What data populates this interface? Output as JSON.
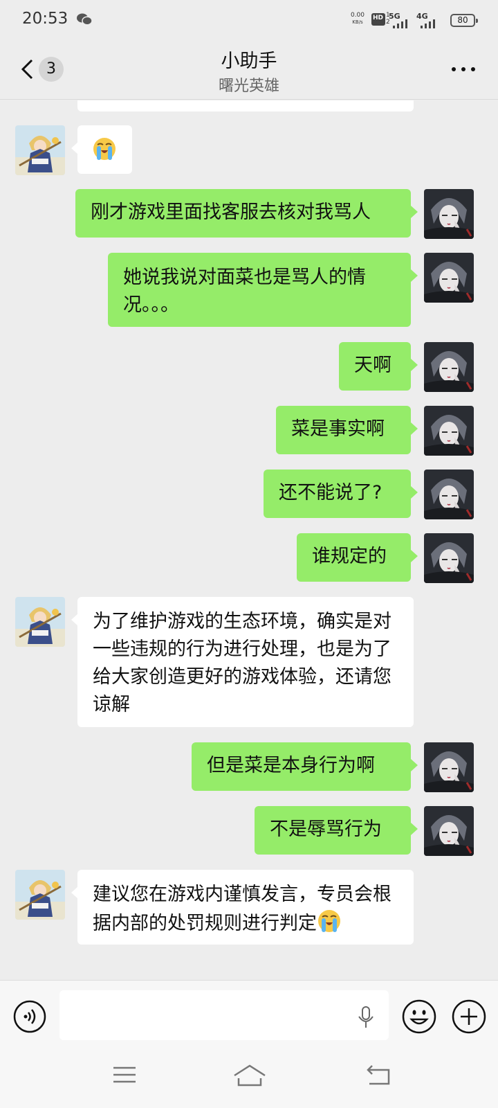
{
  "status_bar": {
    "time": "20:53",
    "net_speed_value": "0.00",
    "net_speed_unit": "KB/s",
    "hd_label": "HD",
    "sim1_gen": "5G",
    "sim2_gen": "4G",
    "battery": "80"
  },
  "header": {
    "back_icon": "chevron-left-icon",
    "unread_count": "3",
    "title": "小助手",
    "subtitle": "曙光英雄",
    "more_icon": "more-dots-icon"
  },
  "messages": [
    {
      "side": "in",
      "text": "",
      "partial": true
    },
    {
      "side": "in",
      "text": "",
      "emoji": "crying-face"
    },
    {
      "side": "out",
      "text": "刚才游戏里面找客服去核对我骂人"
    },
    {
      "side": "out",
      "text": "她说我说对面菜也是骂人的情况。。。"
    },
    {
      "side": "out",
      "text": "天啊"
    },
    {
      "side": "out",
      "text": "菜是事实啊"
    },
    {
      "side": "out",
      "text": "还不能说了?"
    },
    {
      "side": "out",
      "text": "谁规定的"
    },
    {
      "side": "in",
      "text": "为了维护游戏的生态环境，确实是对一些违规的行为进行处理，也是为了给大家创造更好的游戏体验，还请您谅解"
    },
    {
      "side": "out",
      "text": "但是菜是本身行为啊"
    },
    {
      "side": "out",
      "text": "不是辱骂行为"
    },
    {
      "side": "in",
      "text": "建议您在游戏内谨慎发言，专员会根据内部的处罚规则进行判定",
      "emoji": "crying-face"
    }
  ],
  "input_bar": {
    "voice_icon": "voice-mode-icon",
    "input_value": "",
    "mic_icon": "microphone-icon",
    "emoji_icon": "emoji-icon",
    "plus_icon": "plus-icon"
  },
  "nav_bar": {
    "menu_icon": "menu-icon",
    "home_icon": "home-icon",
    "back_icon": "back-icon"
  },
  "colors": {
    "background": "#ededed",
    "outgoing_bubble": "#95ec69",
    "incoming_bubble": "#ffffff"
  }
}
